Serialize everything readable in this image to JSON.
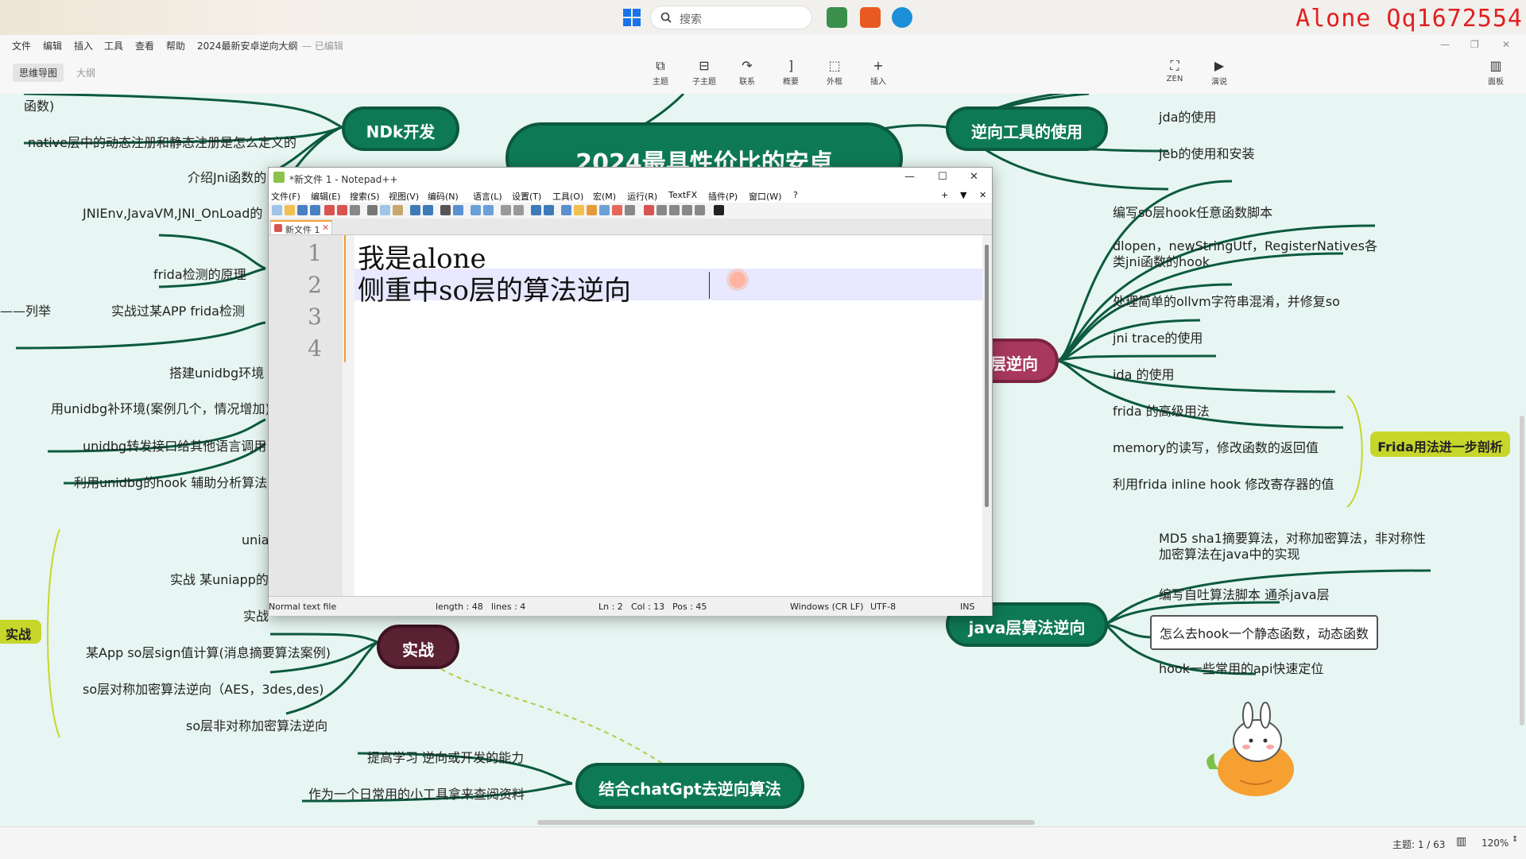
{
  "taskbar": {
    "search_placeholder": "搜索",
    "watermark": "Alone Qq1672554"
  },
  "menubar": {
    "items": [
      "文件",
      "编辑",
      "插入",
      "工具",
      "查看",
      "帮助"
    ],
    "doc_title": "2024最新安卓逆向大纲",
    "edit_status": "— 已编辑"
  },
  "view_tabs": [
    "思维导图",
    "大纲"
  ],
  "toolbar": {
    "topic": "主题",
    "subtopic": "子主题",
    "relation": "联系",
    "summary": "概要",
    "boundary": "外框",
    "insert": "插入",
    "zen": "ZEN",
    "present": "演说",
    "panel": "面板"
  },
  "mindmap": {
    "central": "2024最具性价比的安卓",
    "ndk": {
      "title": "NDk开发",
      "items": [
        "函数)",
        "native层中的动态注册和静态注册是怎么定义的",
        "介绍Jni函数的",
        "JNIEnv,JavaVM,JNI_OnLoad的"
      ]
    },
    "left_mid": {
      "items": [
        "frida检测的原理",
        "实战过某APP frida检测",
        "搭建unidbg环境",
        "用unidbg补环境(案例几个，情况增加)",
        "unidbg转发接口给其他语言调用",
        "利用unidbg的hook 辅助分析算法"
      ],
      "list_fragment": "——列举"
    },
    "practice": {
      "title": "实战",
      "items": [
        "unia",
        "实战 某uniapp的",
        "实战",
        "某App so层sign值计算(消息摘要算法案例)",
        "so层对称加密算法逆向（AES，3des,des)",
        "so层非对称加密算法逆向"
      ],
      "side_label": "实战"
    },
    "reverse_tools": {
      "title": "逆向工具的使用",
      "items": [
        "jda的使用",
        "jeb的使用和安装"
      ]
    },
    "so_layer": {
      "title": "层逆向",
      "items": [
        "编写so层hook任意函数脚本",
        "dlopen，newStringUtf，RegisterNatives各类jni函数的hook",
        "处理简单的ollvm字符串混淆，并修复so",
        "jni trace的使用",
        "ida 的使用",
        "frida 的高级用法",
        "memory的读写，修改函数的返回值",
        "利用frida inline hook 修改寄存器的值"
      ],
      "callout": "Frida用法进一步剖析"
    },
    "java_layer": {
      "title": "java层算法逆向",
      "items": [
        "MD5 sha1摘要算法，对称加密算法，非对称性加密算法在java中的实现",
        "编写自吐算法脚本 通杀java层",
        "怎么去hook一个静态函数，动态函数",
        "hook一些常用的api快速定位"
      ]
    },
    "chatgpt": {
      "title": "结合chatGpt去逆向算法",
      "items": [
        "提高学习 逆向或开发的能力",
        "作为一个日常用的小工具拿来查阅资料"
      ]
    }
  },
  "notepad": {
    "title": "*新文件 1 - Notepad++",
    "menu": [
      "文件(F)",
      "编辑(E)",
      "搜索(S)",
      "视图(V)",
      "编码(N)",
      "语言(L)",
      "设置(T)",
      "工具(O)",
      "宏(M)",
      "运行(R)",
      "TextFX",
      "插件(P)",
      "窗口(W)",
      "?"
    ],
    "tab_label": "新文件 1",
    "line_numbers": [
      "1",
      "2",
      "3",
      "4"
    ],
    "lines": [
      "我是alone",
      "侧重中so层的算法逆向"
    ],
    "status": {
      "type": "Normal text file",
      "length": "length : 48",
      "lines": "lines : 4",
      "ln": "Ln : 2",
      "col": "Col : 13",
      "pos": "Pos : 45",
      "eol": "Windows (CR LF)",
      "encoding": "UTF-8",
      "mode": "INS"
    }
  },
  "statusbar": {
    "topic_count": "主题: 1 / 63",
    "zoom": "120%"
  }
}
